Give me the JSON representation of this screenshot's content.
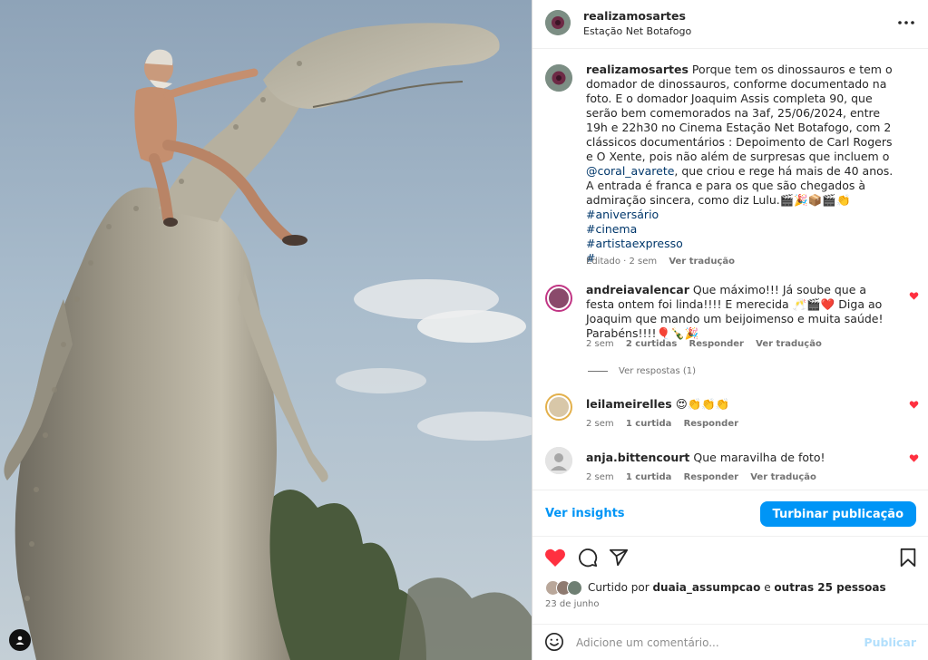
{
  "post": {
    "username": "realizamosartes",
    "location": "Estação Net Botafogo"
  },
  "caption": {
    "username": "realizamosartes",
    "text_before_mention": "Porque tem os dinossauros e tem o domador de dinossauros, conforme documentado na foto. E o domador Joaquim Assis completa 90, que serão bem comemorados na 3af, 25/06/2024, entre 19h e 22h30 no Cinema Estação Net Botafogo, com 2 clássicos documentários : Depoimento de Carl Rogers e O Xente, pois não além de surpresas que incluem o",
    "mention": "@coral_avarete",
    "text_after_mention": ", que criou e rege há mais de 40 anos. A entrada é franca e para os que são chegados à admiração sincera, como diz Lulu.🎬🎉📦🎬👏",
    "hashtags": [
      "#aniversário",
      "#cinema",
      "#artistaexpresso",
      "#"
    ],
    "edited_label": "Editado · 2 sem",
    "translate_label": "Ver tradução"
  },
  "comments": [
    {
      "username": "andreiavalencar",
      "text": "Que máximo!!! Já soube que a festa ontem foi linda!!!! E merecida 🥂🎬❤️ Diga ao Joaquim que mando um beijoimenso e muita saúde! Parabéns!!!!🎈🍾🎉",
      "time": "2 sem",
      "likes": "2 curtidas",
      "reply": "Responder",
      "translate": "Ver tradução"
    },
    {
      "username": "leilameirelles",
      "text": "😍👏👏👏",
      "time": "2 sem",
      "likes": "1 curtida",
      "reply": "Responder"
    },
    {
      "username": "anja.bittencourt",
      "text": "Que maravilha de foto!",
      "time": "2 sem",
      "likes": "1 curtida",
      "reply": "Responder",
      "translate": "Ver tradução"
    }
  ],
  "view_replies": "Ver respostas (1)",
  "actions": {
    "insights": "Ver insights",
    "boost": "Turbinar publicação"
  },
  "likes": {
    "prefix": "Curtido por",
    "user": "duaia_assumpcao",
    "connector": "e",
    "others": "outras 25 pessoas"
  },
  "date": "23 de junho",
  "comment_box": {
    "placeholder": "Adicione um comentário...",
    "publish": "Publicar"
  },
  "colors": {
    "accent_blue": "#0095f6",
    "like_red": "#ff3040",
    "link_dark": "#00376b",
    "muted": "#737373"
  },
  "icons": [
    "more-icon",
    "heart-icon",
    "comment-icon",
    "share-icon",
    "bookmark-icon",
    "emoji-icon",
    "tag-user-icon"
  ]
}
